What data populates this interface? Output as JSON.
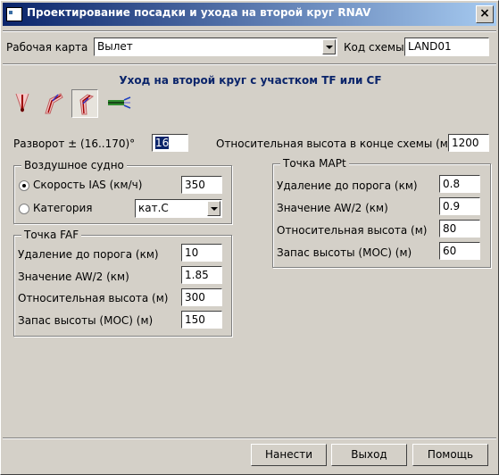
{
  "window": {
    "title": "Проектирование посадки и ухода на второй круг RNAV"
  },
  "top": {
    "map_label": "Рабочая карта",
    "map_value": "Вылет",
    "scheme_label": "Код схемы",
    "scheme_value": "LAND01"
  },
  "heading": "Уход на второй круг с участком TF или CF",
  "tools": [
    {
      "name": "approach-straight-icon"
    },
    {
      "name": "approach-turn-icon"
    },
    {
      "name": "approach-turn-back-icon",
      "active": true
    },
    {
      "name": "approach-runway-icon"
    }
  ],
  "turn": {
    "label": "Разворот ± (16..170)°",
    "value": "16"
  },
  "rel_height_end": {
    "label": "Относительная высота в конце схемы (м)",
    "value": "1200"
  },
  "aircraft": {
    "title": "Воздушное судно",
    "ias_label": "Скорость IAS (км/ч)",
    "ias_value": "350",
    "category_label": "Категория",
    "category_value": "кат.С"
  },
  "faf": {
    "title": "Точка FAF",
    "dist_label": "Удаление до порога (км)",
    "dist_value": "10",
    "aw_label": "Значение AW/2 (км)",
    "aw_value": "1.85",
    "height_label": "Относительная высота (м)",
    "height_value": "300",
    "moc_label": "Запас высоты (МОС) (м)",
    "moc_value": "150"
  },
  "mapt": {
    "title": "Точка MAPt",
    "dist_label": "Удаление до порога (км)",
    "dist_value": "0.8",
    "aw_label": "Значение AW/2 (км)",
    "aw_value": "0.9",
    "height_label": "Относительная высота (м)",
    "height_value": "80",
    "moc_label": "Запас высоты (МОС) (м)",
    "moc_value": "60"
  },
  "buttons": {
    "apply": "Нанести",
    "exit": "Выход",
    "help": "Помощь"
  },
  "colors": {
    "titlebar": "#0a246a",
    "heading": "#0a246a",
    "face": "#d4d0c8"
  }
}
